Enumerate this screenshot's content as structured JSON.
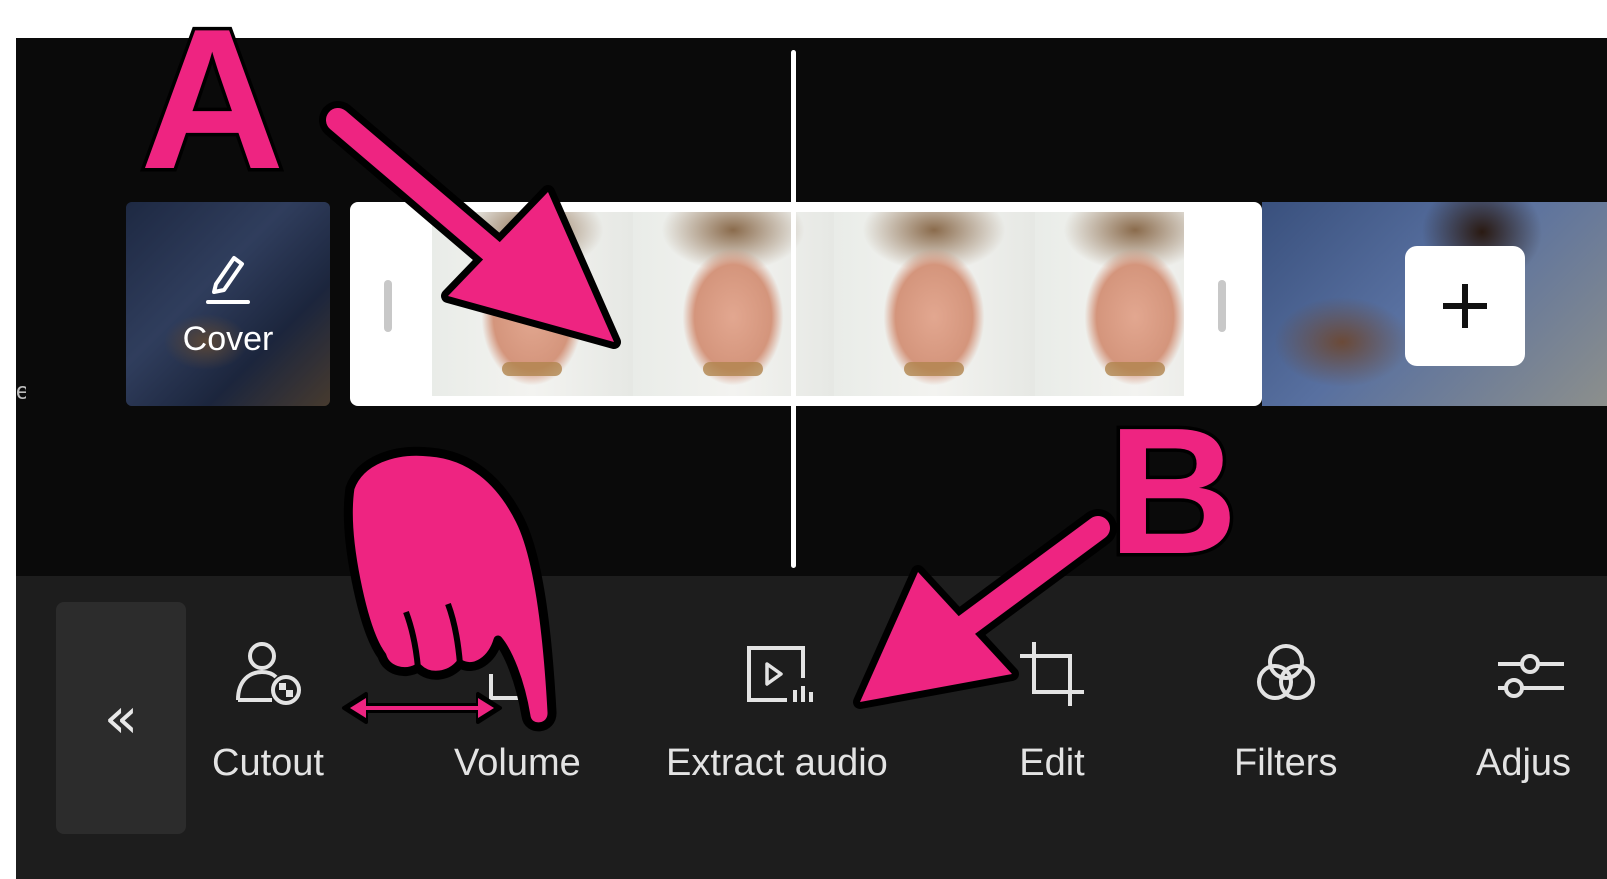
{
  "edge_partial_text": "e",
  "timeline": {
    "cover_label": "Cover"
  },
  "toolbar": {
    "collapse_glyph": "«",
    "tools": [
      {
        "id": "cutout",
        "label": "Cutout",
        "icon": "cutout-icon"
      },
      {
        "id": "volume",
        "label": "Volume",
        "icon": "volume-icon"
      },
      {
        "id": "extract-audio",
        "label": "Extract audio",
        "icon": "extract-audio-icon"
      },
      {
        "id": "edit",
        "label": "Edit",
        "icon": "crop-icon"
      },
      {
        "id": "filters",
        "label": "Filters",
        "icon": "filters-icon"
      },
      {
        "id": "adjust",
        "label": "Adjus",
        "icon": "adjust-sliders-icon"
      }
    ]
  },
  "annotations": {
    "letter_a": "A",
    "letter_b": "B"
  },
  "colors": {
    "annotation": "#ee2481",
    "background": "#0a0a0a",
    "toolbar": "#1d1d1d",
    "text": "#e3e3e3"
  }
}
